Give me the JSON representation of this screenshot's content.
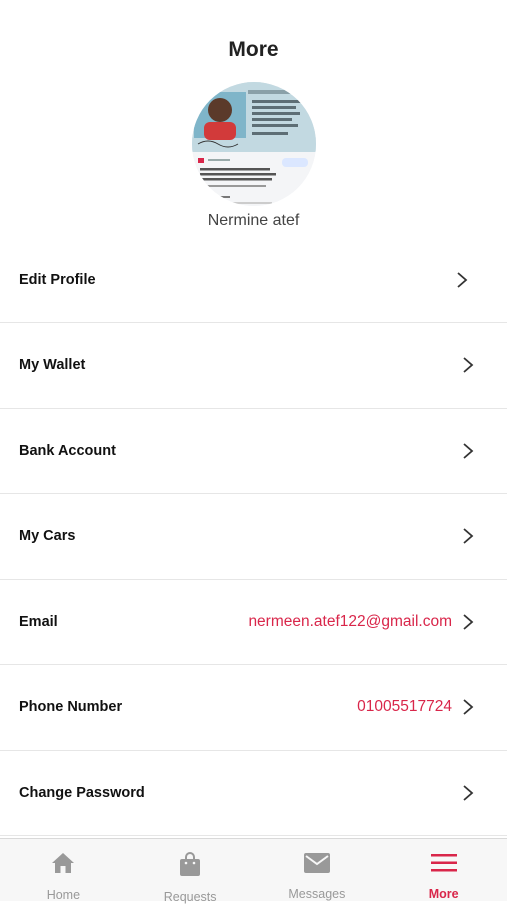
{
  "header": {
    "title": "More",
    "user_name": "Nermine atef"
  },
  "menu": {
    "items": [
      {
        "label": "Edit Profile",
        "value": ""
      },
      {
        "label": "My Wallet",
        "value": ""
      },
      {
        "label": "Bank Account",
        "value": ""
      },
      {
        "label": "My Cars",
        "value": ""
      },
      {
        "label": "Email",
        "value": "nermeen.atef122@gmail.com"
      },
      {
        "label": "Phone Number",
        "value": "01005517724"
      },
      {
        "label": "Change Password",
        "value": ""
      }
    ]
  },
  "tabbar": {
    "tabs": [
      {
        "label": "Home",
        "icon": "home-icon"
      },
      {
        "label": "Requests",
        "icon": "shopping-bag-icon"
      },
      {
        "label": "Messages",
        "icon": "envelope-icon"
      },
      {
        "label": "More",
        "icon": "menu-icon",
        "active": true
      }
    ]
  },
  "colors": {
    "accent": "#d9264a",
    "inactive": "#999999",
    "divider": "#e6e6e6"
  }
}
